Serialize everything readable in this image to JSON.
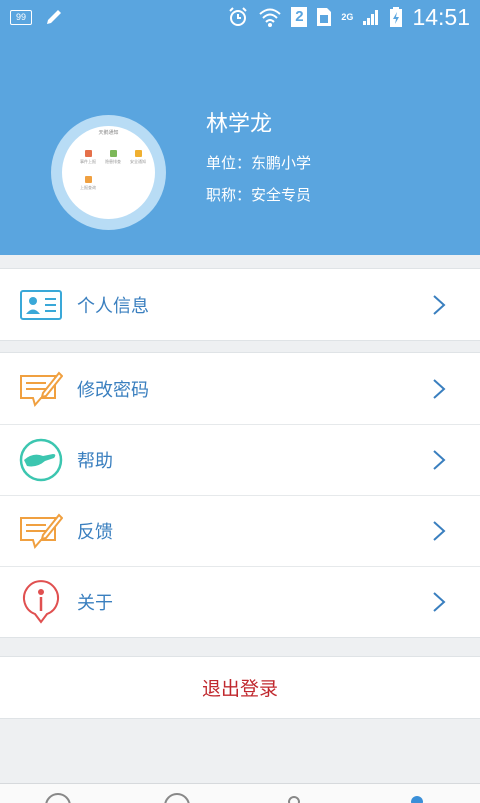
{
  "status_bar": {
    "battery_small": "99",
    "sim_badge": "2",
    "network": "2G",
    "time": "14:51",
    "icons": [
      "battery-icon",
      "edit-icon",
      "alarm-icon",
      "wifi-icon",
      "sim-icon",
      "signal-icon",
      "charging-icon"
    ]
  },
  "profile": {
    "name": "林学龙",
    "unit": "单位：东鹏小学",
    "title": "职称：安全专员",
    "avatar_topline": "天鹅通知",
    "avatar_cells": [
      "事件上报",
      "隐患排查",
      "安全通知",
      "上报查询"
    ]
  },
  "menu": {
    "personal_info": "个人信息",
    "change_password": "修改密码",
    "help": "帮助",
    "feedback": "反馈",
    "about": "关于"
  },
  "logout": {
    "label": "退出登录"
  },
  "colors": {
    "header_bg": "#5aa5df",
    "menu_text": "#3a7fbf",
    "logout_text": "#c0282e",
    "icon_orange": "#f0a040",
    "icon_teal": "#3cc6b0",
    "icon_red": "#e05050"
  }
}
